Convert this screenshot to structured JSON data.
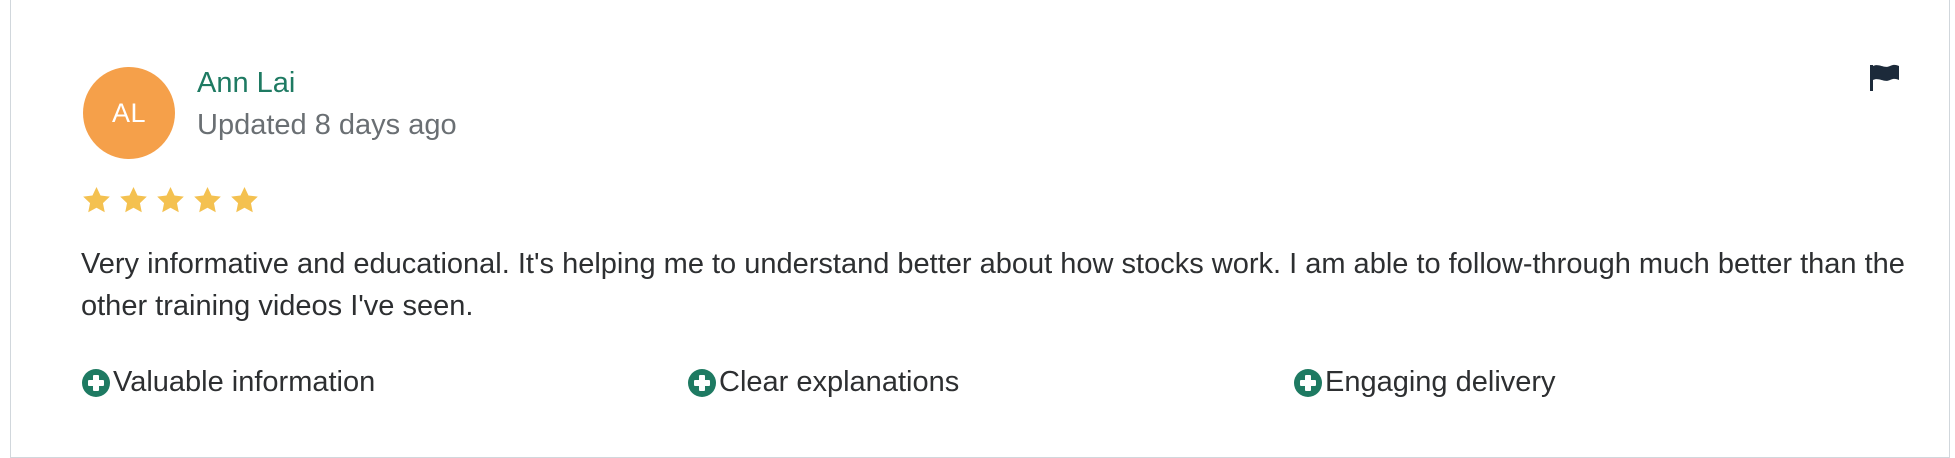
{
  "review": {
    "avatar_initials": "AL",
    "author_name": "Ann Lai",
    "updated_text": "Updated 8 days ago",
    "rating": 5,
    "rating_max": 5,
    "text": "Very informative and educational. It's helping me to understand better about how stocks work. I am able to follow-through much better than the other training videos I've seen.",
    "tags": [
      {
        "label": "Valuable information",
        "icon": "plus-circle-icon"
      },
      {
        "label": "Clear explanations",
        "icon": "plus-circle-icon"
      },
      {
        "label": "Engaging delivery",
        "icon": "plus-circle-icon"
      }
    ],
    "report_icon": "flag-icon"
  },
  "colors": {
    "avatar_bg": "#f5a04a",
    "author_name": "#1e7a62",
    "star": "#f4c150",
    "tag_icon": "#1e7a62",
    "flag": "#1c2a3a",
    "text": "#2d2f31",
    "muted": "#6a6f73"
  }
}
